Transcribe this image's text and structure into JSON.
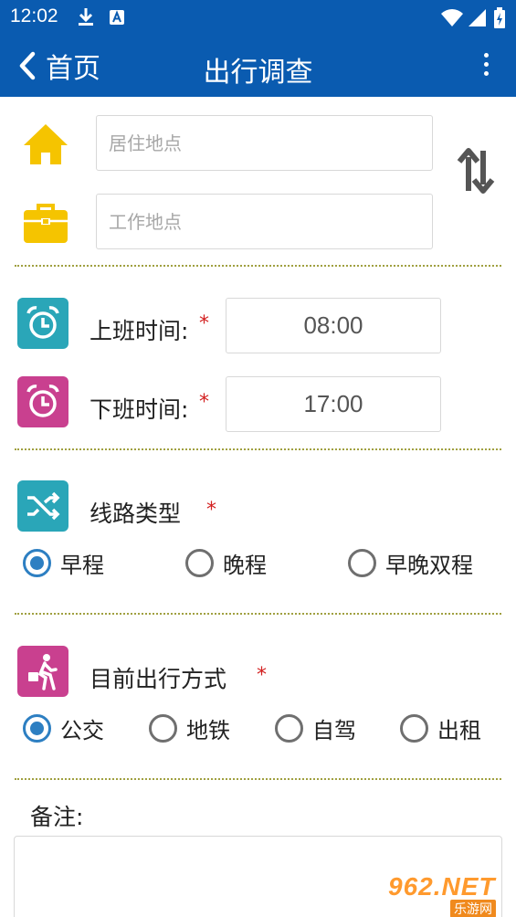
{
  "status_bar": {
    "time": "12:02"
  },
  "app_bar": {
    "back_label": "首页",
    "title": "出行调查"
  },
  "location": {
    "home_placeholder": "居住地点",
    "work_placeholder": "工作地点"
  },
  "times": {
    "start_label": "上班时间:",
    "start_value": "08:00",
    "end_label": "下班时间:",
    "end_value": "17:00",
    "required_mark": "*"
  },
  "route_type": {
    "label": "线路类型",
    "required_mark": "*",
    "options": [
      "早程",
      "晚程",
      "早晚双程"
    ],
    "selected": "早程"
  },
  "travel_mode": {
    "label": "目前出行方式",
    "required_mark": "*",
    "options": [
      "公交",
      "地铁",
      "自驾",
      "出租"
    ],
    "selected": "公交"
  },
  "notes": {
    "label": "备注:",
    "value": ""
  },
  "watermark": {
    "main": "962.NET",
    "sub": "乐游网"
  },
  "colors": {
    "app_bar": "#0a5bb0",
    "accent_blue": "#2d7fc2",
    "home_icon": "#f5c400",
    "work_icon": "#f5c400",
    "start_time_tile": "#2aa6b8",
    "end_time_tile": "#c9408f",
    "route_tile": "#2aa6b8",
    "mode_tile": "#c9408f",
    "required": "#d32020"
  },
  "icons": {
    "home": "home-icon",
    "work": "briefcase-icon",
    "swap": "swap-vertical-icon",
    "start_time": "alarm-clock-icon",
    "end_time": "alarm-clock-icon",
    "route": "shuffle-icon",
    "mode": "walking-person-icon"
  }
}
